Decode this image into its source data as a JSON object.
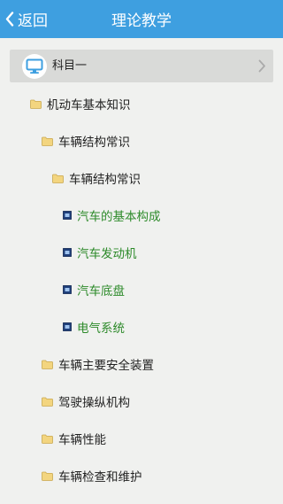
{
  "header": {
    "back_label": "返回",
    "title": "理论教学",
    "background": "#3e9fe0"
  },
  "subject": {
    "label": "科目一",
    "icon": "monitor-icon"
  },
  "tree": [
    {
      "label": "机动车基本知识",
      "level": 1,
      "kind": "folder"
    },
    {
      "label": "车辆结构常识",
      "level": 2,
      "kind": "folder"
    },
    {
      "label": "车辆结构常识",
      "level": 3,
      "kind": "folder"
    },
    {
      "label": "汽车的基本构成",
      "level": 4,
      "kind": "document"
    },
    {
      "label": "汽车发动机",
      "level": 4,
      "kind": "document"
    },
    {
      "label": "汽车底盘",
      "level": 4,
      "kind": "document"
    },
    {
      "label": "电气系统",
      "level": 4,
      "kind": "document"
    },
    {
      "label": "车辆主要安全装置",
      "level": 2,
      "kind": "folder"
    },
    {
      "label": "驾驶操纵机构",
      "level": 2,
      "kind": "folder"
    },
    {
      "label": "车辆性能",
      "level": 2,
      "kind": "folder"
    },
    {
      "label": "车辆检查和维护",
      "level": 2,
      "kind": "folder"
    }
  ],
  "colors": {
    "lesson_text": "#2d8a2a",
    "folder": "#f3d57f"
  }
}
